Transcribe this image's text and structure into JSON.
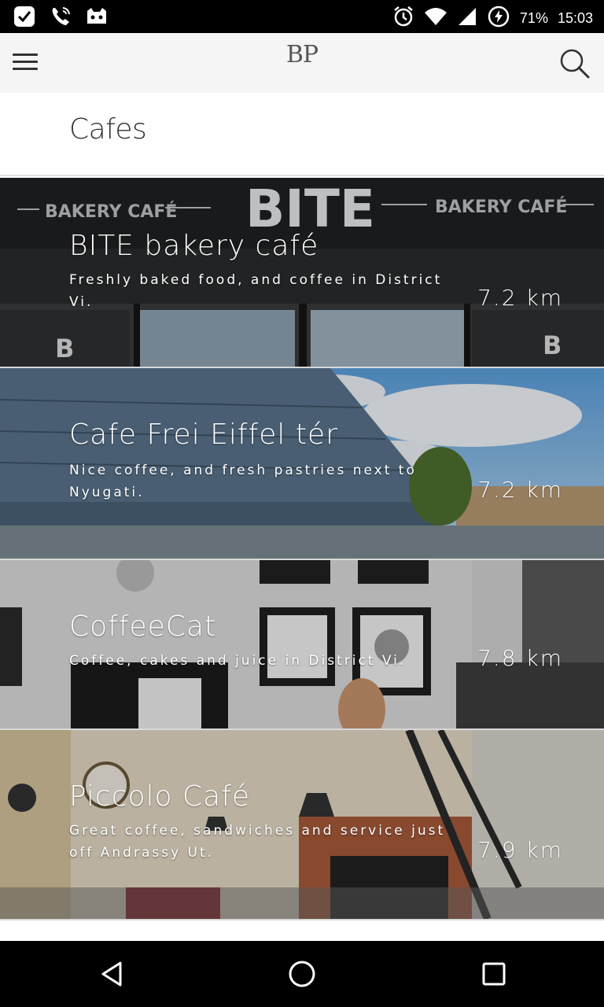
{
  "status_bar": {
    "battery_text": "71%",
    "time": "15:03",
    "icons_left": [
      "checkbox-icon",
      "phone-icon",
      "cat-icon"
    ],
    "icons_right": [
      "alarm-icon",
      "wifi-icon",
      "signal-icon",
      "battery-charging-icon"
    ]
  },
  "app_bar": {
    "logo": "BP",
    "menu_icon": "hamburger-menu-icon",
    "search_icon": "search-icon"
  },
  "page": {
    "title": "Cafes"
  },
  "cafes": [
    {
      "name": "BITE bakery café",
      "description": "Freshly baked food, and coffee in District Vi.",
      "distance": "7.2 km"
    },
    {
      "name": "Cafe Frei Eiffel tér",
      "description": "Nice coffee, and fresh pastries next to Nyugati.",
      "distance": "7.2 km"
    },
    {
      "name": "CoffeeCat",
      "description": "Coffee, cakes and juice in District Vi.",
      "distance": "7.8 km"
    },
    {
      "name": "Piccolo Café",
      "description": "Great coffee, sandwiches and service just off Andrassy Ut.",
      "distance": "7.9 km"
    }
  ],
  "nav_bar": {
    "back_icon": "back-icon",
    "home_icon": "home-icon",
    "recents_icon": "recents-icon"
  }
}
